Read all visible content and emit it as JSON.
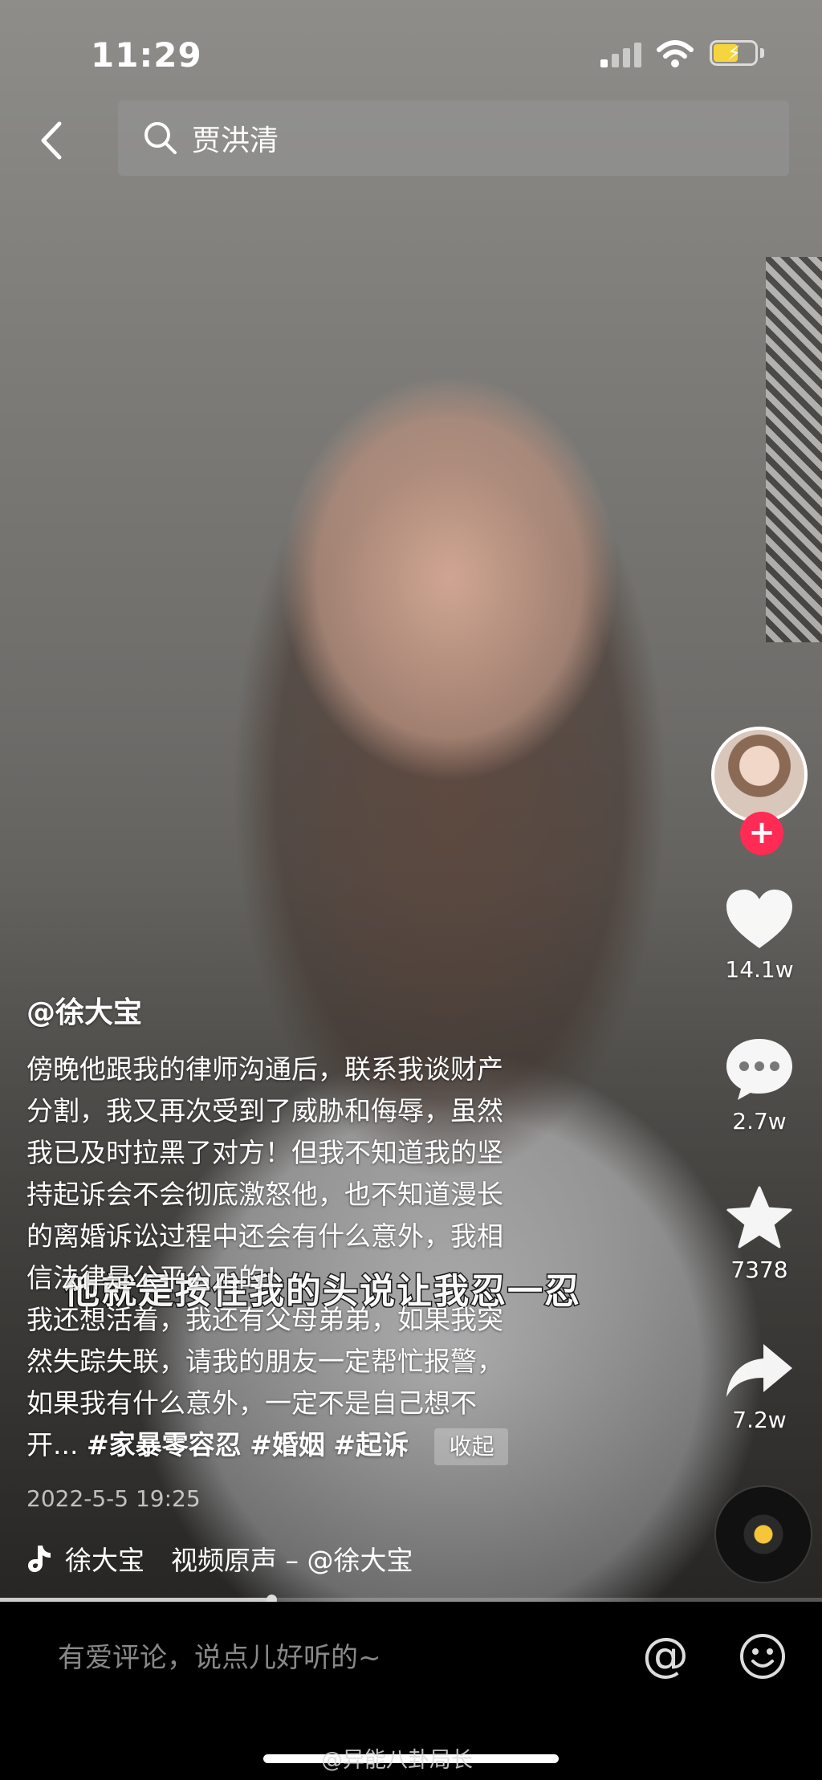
{
  "status_bar": {
    "time": "11:29"
  },
  "search": {
    "query": "贾洪清"
  },
  "video": {
    "author_handle": "@徐大宝",
    "caption_lines": [
      "傍晚他跟我的律师沟通后，联系我谈财产",
      "分割，我又再次受到了威胁和侮辱，虽然",
      "我已及时拉黑了对方！但我不知道我的坚",
      "持起诉会不会彻底激怒他，也不知道漫长",
      "的离婚诉讼过程中还会有什么意外，我相",
      "信法律是公平公正的！",
      "我还想活着，我还有父母弟弟，如果我突",
      "然失踪失联，请我的朋友一定帮忙报警，",
      "如果我有什么意外，一定不是自己想不"
    ],
    "caption_last_prefix": "开...",
    "hashtags": [
      "#家暴零容忍",
      "#婚姻",
      "#起诉"
    ],
    "collapse_label": "收起",
    "subtitle": "他就是按住我的头说让我忍一忍",
    "date": "2022-5-5 19:25",
    "music_text": "徐大宝　视频原声 – @徐大宝",
    "progress": 0.33
  },
  "actions": {
    "follow_label": "+",
    "likes": "14.1w",
    "comments": "2.7w",
    "favorites": "7378",
    "shares": "7.2w"
  },
  "comment_bar": {
    "placeholder": "有爱评论，说点儿好听的~",
    "at_label": "@",
    "watermark": "@异能八卦局长"
  },
  "colors": {
    "follow": "#fe2c55",
    "battery": "#f5d53d"
  },
  "icons": [
    "back-icon",
    "search-icon",
    "heart-icon",
    "comment-icon",
    "star-icon",
    "share-icon",
    "music-note-icon",
    "emoji-icon"
  ]
}
